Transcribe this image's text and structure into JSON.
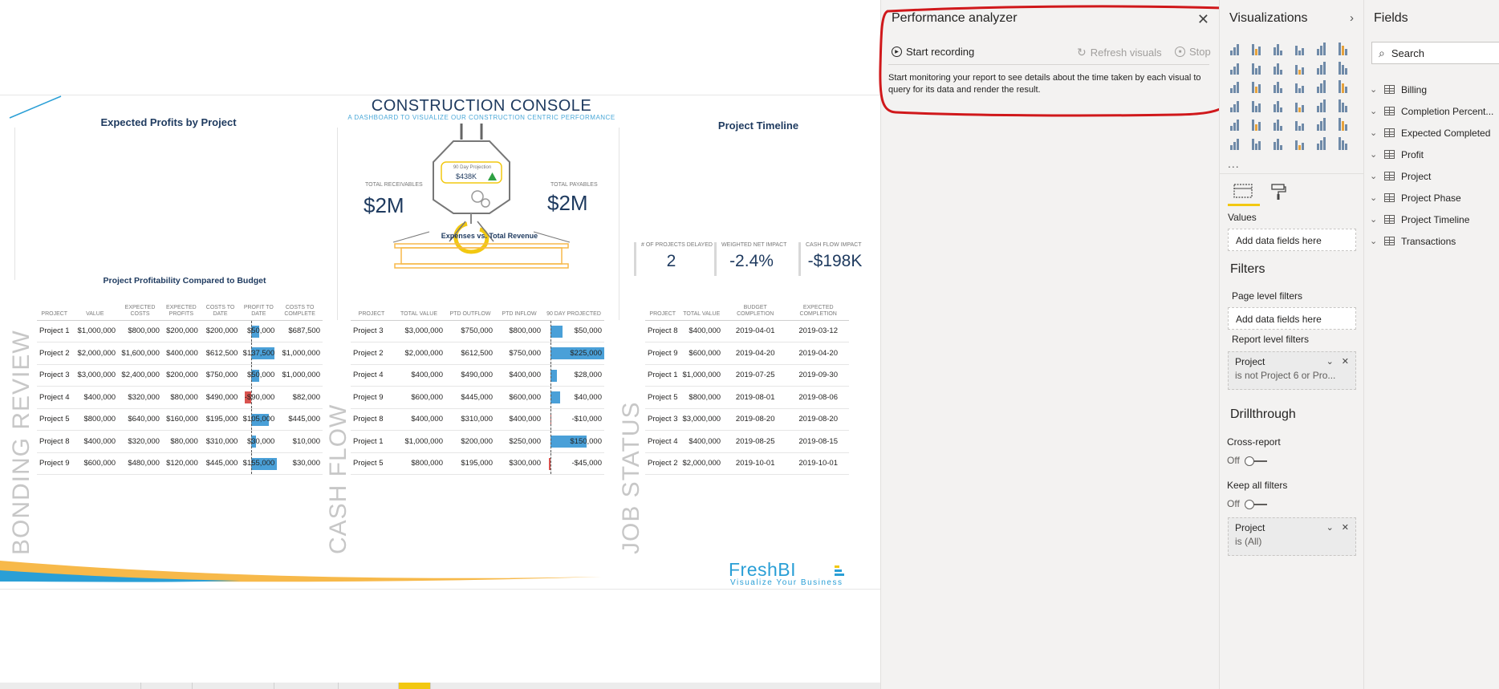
{
  "report": {
    "expected_profits_title": "Expected Profits by Project",
    "profitability_title": "Project Profitability Compared to Budget",
    "console_title": "CONSTRUCTION CONSOLE",
    "console_subtitle": "A DASHBOARD TO VISUALIZE OUR CONSTRUCTION CENTRIC PERFORMANCE",
    "projection_label": "90 Day Projection",
    "projection_value": "$438K",
    "total_receivables_label": "TOTAL RECEIVABLES",
    "total_receivables_value": "$2M",
    "total_payables_label": "TOTAL PAYABLES",
    "total_payables_value": "$2M",
    "expenses_title": "Expenses vs. Total Revenue",
    "timeline_title": "Project Timeline",
    "kpis": [
      {
        "label": "# OF PROJECTS DELAYED",
        "value": "2"
      },
      {
        "label": "WEIGHTED NET IMPACT",
        "value": "-2.4%"
      },
      {
        "label": "CASH FLOW IMPACT",
        "value": "-$198K"
      }
    ],
    "section_titles": {
      "bonding": "BONDING REVIEW",
      "cashflow": "CASH FLOW",
      "jobstatus": "JOB STATUS"
    },
    "bonding_table": {
      "headers": [
        "PROJECT",
        "VALUE",
        "EXPECTED COSTS",
        "EXPECTED PROFITS",
        "COSTS TO DATE",
        "PROFIT TO DATE",
        "COSTS TO COMPLETE"
      ],
      "rows": [
        {
          "project": "Project 1",
          "value": "$1,000,000",
          "exp_costs": "$800,000",
          "exp_profits": "$200,000",
          "costs_to_date": "$200,000",
          "profit_to_date": "$50,000",
          "profit_num": 50000,
          "costs_to_complete": "$687,500"
        },
        {
          "project": "Project 2",
          "value": "$2,000,000",
          "exp_costs": "$1,600,000",
          "exp_profits": "$400,000",
          "costs_to_date": "$612,500",
          "profit_to_date": "$137,500",
          "profit_num": 137500,
          "costs_to_complete": "$1,000,000"
        },
        {
          "project": "Project 3",
          "value": "$3,000,000",
          "exp_costs": "$2,400,000",
          "exp_profits": "$200,000",
          "costs_to_date": "$750,000",
          "profit_to_date": "$50,000",
          "profit_num": 50000,
          "costs_to_complete": "$1,000,000"
        },
        {
          "project": "Project 4",
          "value": "$400,000",
          "exp_costs": "$320,000",
          "exp_profits": "$80,000",
          "costs_to_date": "$490,000",
          "profit_to_date": "-$90,000",
          "profit_num": -90000,
          "costs_to_complete": "$82,000"
        },
        {
          "project": "Project 5",
          "value": "$800,000",
          "exp_costs": "$640,000",
          "exp_profits": "$160,000",
          "costs_to_date": "$195,000",
          "profit_to_date": "$105,000",
          "profit_num": 105000,
          "costs_to_complete": "$445,000"
        },
        {
          "project": "Project 8",
          "value": "$400,000",
          "exp_costs": "$320,000",
          "exp_profits": "$80,000",
          "costs_to_date": "$310,000",
          "profit_to_date": "$30,000",
          "profit_num": 30000,
          "costs_to_complete": "$10,000"
        },
        {
          "project": "Project 9",
          "value": "$600,000",
          "exp_costs": "$480,000",
          "exp_profits": "$120,000",
          "costs_to_date": "$445,000",
          "profit_to_date": "$155,000",
          "profit_num": 155000,
          "costs_to_complete": "$30,000"
        }
      ]
    },
    "cashflow_table": {
      "headers": [
        "PROJECT",
        "TOTAL VALUE",
        "PTD OUTFLOW",
        "PTD INFLOW",
        "90 DAY PROJECTED"
      ],
      "rows": [
        {
          "project": "Project 3",
          "total_value": "$3,000,000",
          "outflow": "$750,000",
          "inflow": "$800,000",
          "projected": "$50,000",
          "projected_num": 50000
        },
        {
          "project": "Project 2",
          "total_value": "$2,000,000",
          "outflow": "$612,500",
          "inflow": "$750,000",
          "projected": "$225,000",
          "projected_num": 225000
        },
        {
          "project": "Project 4",
          "total_value": "$400,000",
          "outflow": "$490,000",
          "inflow": "$400,000",
          "projected": "$28,000",
          "projected_num": 28000
        },
        {
          "project": "Project 9",
          "total_value": "$600,000",
          "outflow": "$445,000",
          "inflow": "$600,000",
          "projected": "$40,000",
          "projected_num": 40000
        },
        {
          "project": "Project 8",
          "total_value": "$400,000",
          "outflow": "$310,000",
          "inflow": "$400,000",
          "projected": "-$10,000",
          "projected_num": -10000
        },
        {
          "project": "Project 1",
          "total_value": "$1,000,000",
          "outflow": "$200,000",
          "inflow": "$250,000",
          "projected": "$150,000",
          "projected_num": 150000
        },
        {
          "project": "Project 5",
          "total_value": "$800,000",
          "outflow": "$195,000",
          "inflow": "$300,000",
          "projected": "-$45,000",
          "projected_num": -45000
        }
      ]
    },
    "jobstatus_table": {
      "headers": [
        "PROJECT",
        "TOTAL VALUE",
        "BUDGET COMPLETION",
        "EXPECTED COMPLETION"
      ],
      "rows": [
        {
          "project": "Project 8",
          "total_value": "$400,000",
          "budget": "2019-04-01",
          "expected": "2019-03-12"
        },
        {
          "project": "Project 9",
          "total_value": "$600,000",
          "budget": "2019-04-20",
          "expected": "2019-04-20"
        },
        {
          "project": "Project 1",
          "total_value": "$1,000,000",
          "budget": "2019-07-25",
          "expected": "2019-09-30"
        },
        {
          "project": "Project 5",
          "total_value": "$800,000",
          "budget": "2019-08-01",
          "expected": "2019-08-06"
        },
        {
          "project": "Project 3",
          "total_value": "$3,000,000",
          "budget": "2019-08-20",
          "expected": "2019-08-20"
        },
        {
          "project": "Project 4",
          "total_value": "$400,000",
          "budget": "2019-08-25",
          "expected": "2019-08-15"
        },
        {
          "project": "Project 2",
          "total_value": "$2,000,000",
          "budget": "2019-10-01",
          "expected": "2019-10-01"
        }
      ]
    },
    "logo_name": "FreshBI",
    "logo_tagline": "Visualize Your Business"
  },
  "colors": {
    "navy": "#1e3a5f",
    "bar_blue": "#4aa0d8",
    "bar_red": "#d9534f",
    "accent_yellow": "#f2c811",
    "annotation_red": "#d0181b",
    "swoosh_orange": "#f7b94a",
    "swoosh_blue": "#2a9fd6"
  },
  "perf": {
    "title": "Performance analyzer",
    "close_icon": "close-icon",
    "start_recording": "Start recording",
    "refresh_visuals": "Refresh visuals",
    "stop": "Stop",
    "description": "Start monitoring your report to see details about the time taken by each visual to query for its data and render the result."
  },
  "viz": {
    "title": "Visualizations",
    "more": "...",
    "values_label": "Values",
    "values_well": "Add data fields here",
    "filters_title": "Filters",
    "page_filters_label": "Page level filters",
    "page_filters_well": "Add data fields here",
    "report_filters_label": "Report level filters",
    "report_filter": {
      "name": "Project",
      "value": "is not Project 6 or Pro..."
    },
    "drillthrough_title": "Drillthrough",
    "cross_report_label": "Cross-report",
    "cross_report_state": "Off",
    "keep_filters_label": "Keep all filters",
    "keep_filters_state": "Off",
    "drill_filter": {
      "name": "Project",
      "value": "is (All)"
    }
  },
  "fields": {
    "title": "Fields",
    "search_placeholder": "Search",
    "tables": [
      "Billing",
      "Completion Percent...",
      "Expected Completed",
      "Profit",
      "Project",
      "Project Phase",
      "Project Timeline",
      "Transactions"
    ]
  }
}
